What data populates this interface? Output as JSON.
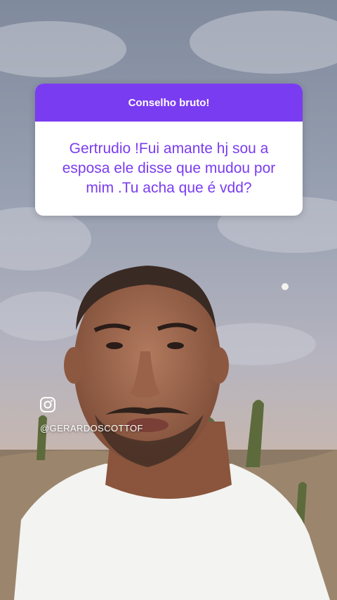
{
  "question_card": {
    "header": "Conselho bruto!",
    "question": "Gertrudio !Fui amante hj  sou a esposa ele disse que mudou por mim .Tu acha que é vdd?",
    "accent_color": "#7a3cf0"
  },
  "overlay": {
    "icon": "instagram-icon",
    "handle": "@GERARDOSCOTTOF"
  }
}
